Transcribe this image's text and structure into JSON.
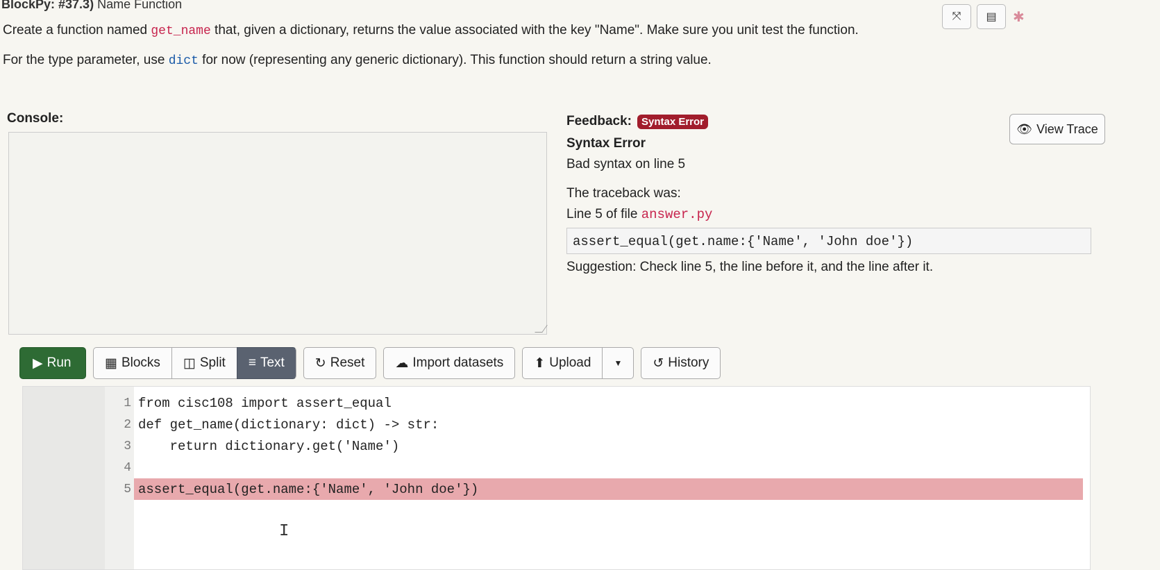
{
  "title": {
    "prefix": "BlockPy: #37.3)",
    "name": "Name Function"
  },
  "instructions": {
    "p1_a": "Create a function named ",
    "p1_code": "get_name",
    "p1_b": " that, given a dictionary, returns the value associated with the key \"Name\". Make sure you unit test the function.",
    "p2_a": "For the type parameter, use ",
    "p2_code": "dict",
    "p2_b": " for now (representing any generic dictionary). This function should return a string value."
  },
  "top_icons": {
    "expand": "⤧",
    "list": "▤",
    "bug": "✱"
  },
  "console": {
    "label": "Console:"
  },
  "feedback": {
    "label": "Feedback:",
    "badge": "Syntax Error",
    "title": "Syntax Error",
    "message": "Bad syntax on line 5",
    "traceback_intro": "The traceback was:",
    "line_prefix": "Line 5 of file ",
    "file": "answer.py",
    "trace_code": "assert_equal(get.name:{'Name', 'John doe'})",
    "suggestion": "Suggestion: Check line 5, the line before it, and the line after it.",
    "view_trace": "View Trace"
  },
  "toolbar": {
    "run": "Run",
    "blocks": "Blocks",
    "split": "Split",
    "text": "Text",
    "reset": "Reset",
    "import": "Import datasets",
    "upload": "Upload",
    "history": "History"
  },
  "editor": {
    "lines": [
      {
        "n": "1",
        "code": "from cisc108 import assert_equal"
      },
      {
        "n": "2",
        "code": "def get_name(dictionary: dict) -> str:"
      },
      {
        "n": "3",
        "code": "    return dictionary.get('Name')"
      },
      {
        "n": "4",
        "code": ""
      },
      {
        "n": "5",
        "code": "assert_equal(get.name:{'Name', 'John doe'})"
      }
    ],
    "error_line": "5"
  },
  "colors": {
    "run_bg": "#2e6b34",
    "badge_bg": "#a11d2c",
    "error_highlight": "#e8a9ad",
    "active_tab": "#5a6270"
  }
}
